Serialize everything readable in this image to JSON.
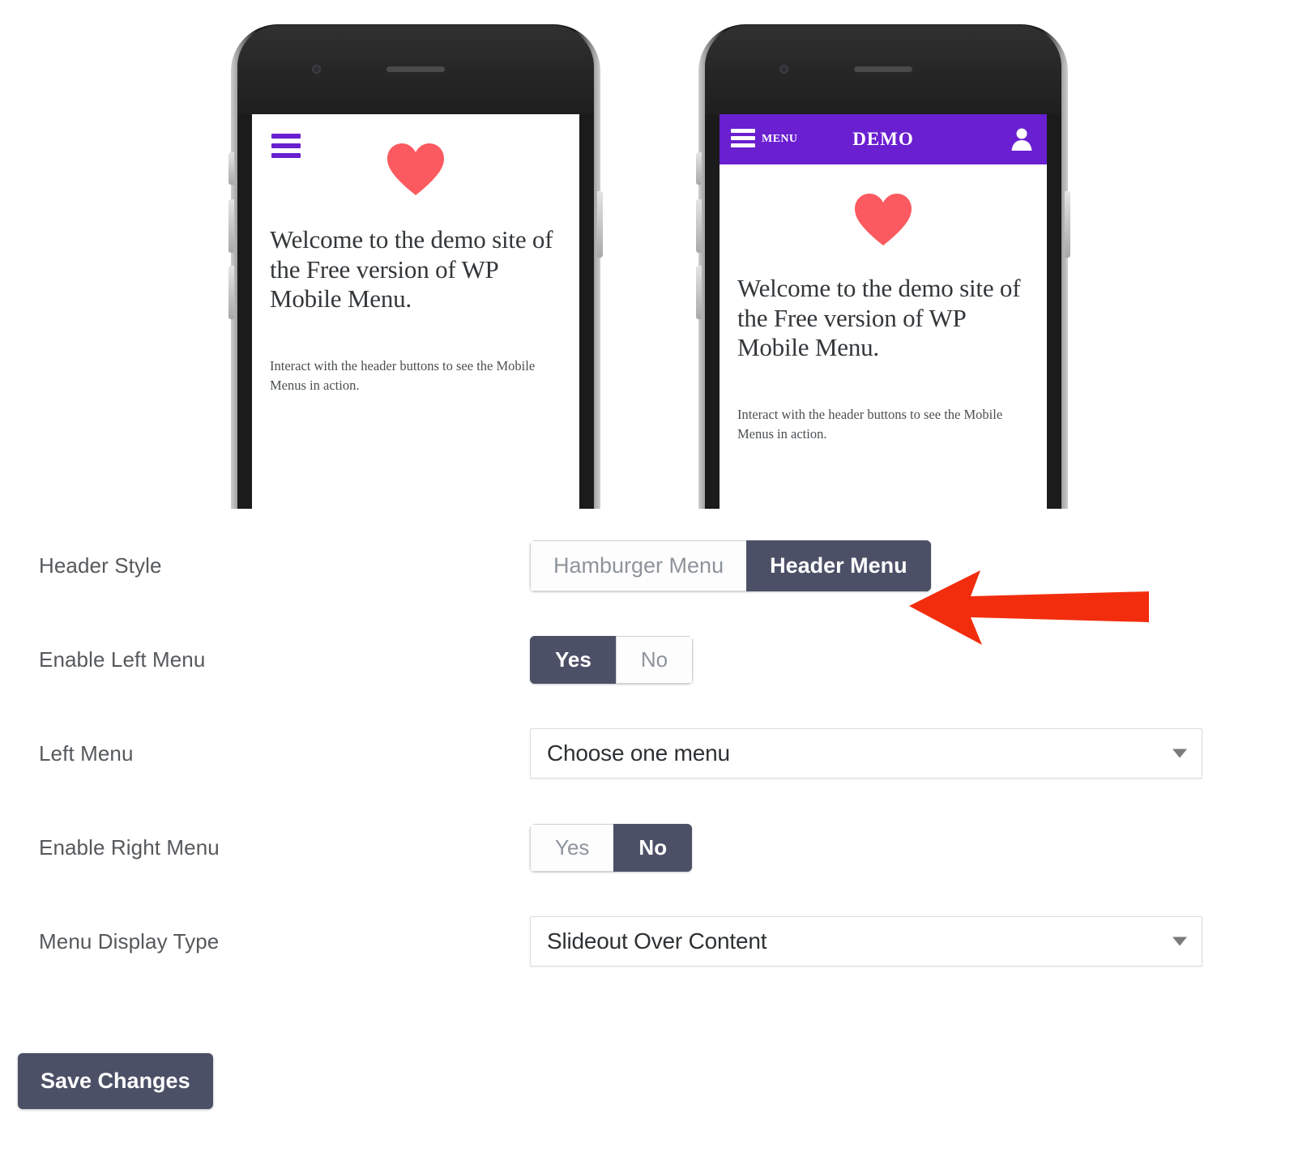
{
  "preview": {
    "phones": [
      {
        "variant": "hamburger",
        "header": {
          "hamburger_icon": "hamburger-icon"
        },
        "content": {
          "heart_icon": "heart-icon",
          "headline": "Welcome to the demo site of the Free version of WP Mobile Menu.",
          "subline": "Interact with the header buttons to see the Mobile Menus in action."
        }
      },
      {
        "variant": "header-bar",
        "header": {
          "hamburger_icon": "hamburger-icon",
          "menu_label": "MENU",
          "title": "DEMO",
          "account_icon": "person-icon",
          "bar_color": "#6a1fd0"
        },
        "content": {
          "heart_icon": "heart-icon",
          "headline": "Welcome to the demo site of the Free version of WP Mobile Menu.",
          "subline": "Interact with the header buttons to see the Mobile Menus in action."
        }
      }
    ]
  },
  "settings": {
    "rows": [
      {
        "label": "Header Style",
        "type": "segmented",
        "options": [
          "Hamburger Menu",
          "Header Menu"
        ],
        "selected": "Header Menu"
      },
      {
        "label": "Enable Left Menu",
        "type": "segmented",
        "options": [
          "Yes",
          "No"
        ],
        "selected": "Yes"
      },
      {
        "label": "Left Menu",
        "type": "select",
        "value": "Choose one menu",
        "caret_icon": "chevron-down-icon"
      },
      {
        "label": "Enable Right Menu",
        "type": "segmented",
        "options": [
          "Yes",
          "No"
        ],
        "selected": "No"
      },
      {
        "label": "Menu Display Type",
        "type": "select",
        "value": "Slideout Over Content",
        "caret_icon": "chevron-down-icon"
      }
    ],
    "save_label": "Save Changes"
  },
  "annotation": {
    "arrow_icon": "left-arrow-annotation",
    "color": "#f22d0d"
  },
  "colors": {
    "accent_purple": "#6a1fd0",
    "heart_red": "#fb5a60",
    "active_slate": "#4c5067",
    "arrow_red": "#f22d0d"
  }
}
